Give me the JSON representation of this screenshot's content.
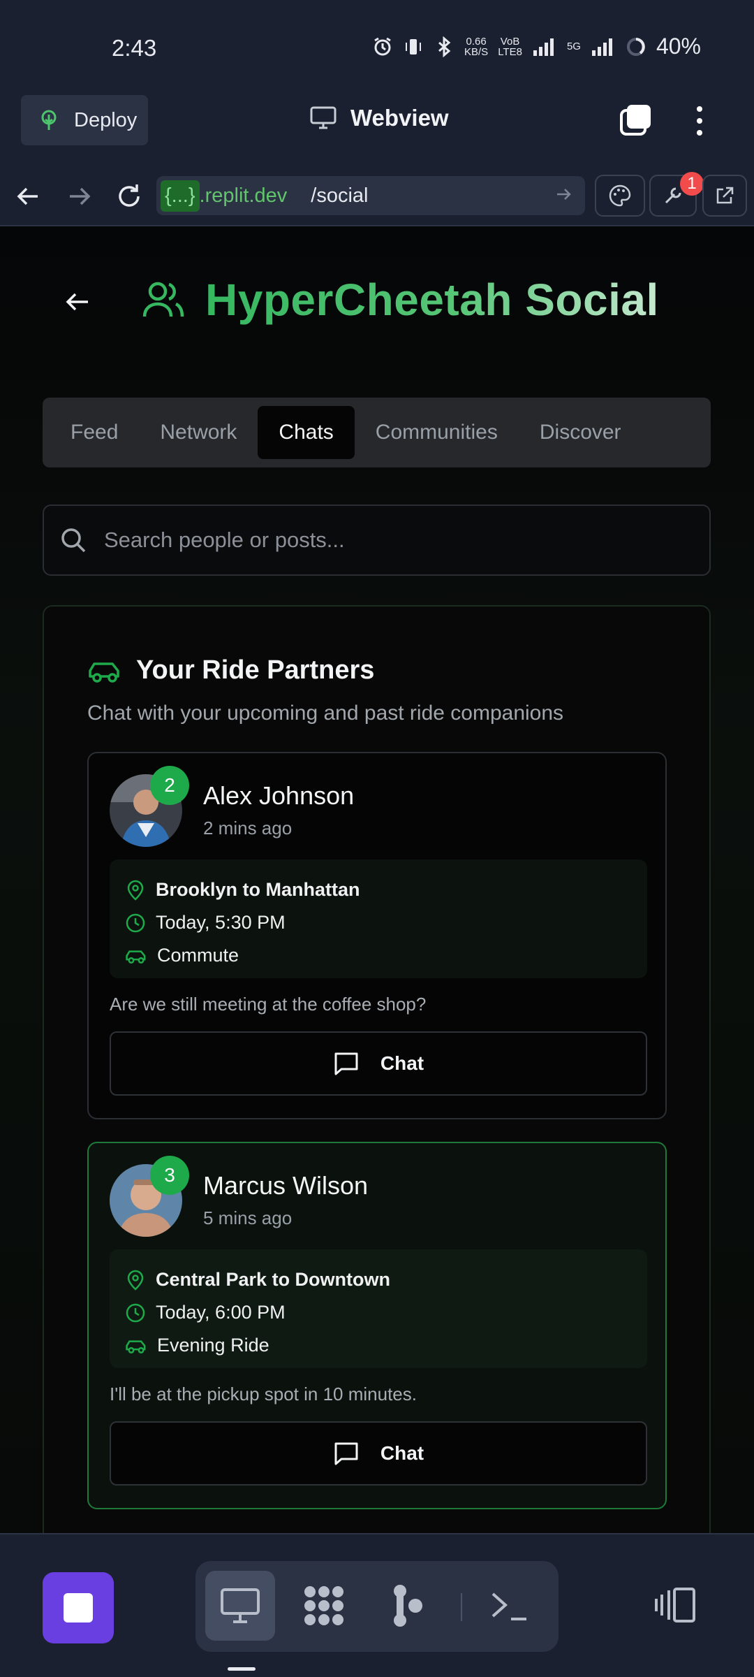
{
  "status_bar": {
    "time": "2:43",
    "net_speed_value": "0.66",
    "net_speed_unit": "KB/S",
    "volte_top": "VoB",
    "volte_bottom": "LTE8",
    "network": "5G",
    "battery": "40%"
  },
  "toolbar": {
    "deploy_label": "Deploy",
    "title": "Webview"
  },
  "address": {
    "badge": "{...}",
    "domain": ".replit.dev",
    "path": "/social",
    "notification_count": "1"
  },
  "page": {
    "title": "HyperCheetah Social",
    "tabs": [
      {
        "label": "Feed",
        "active": false
      },
      {
        "label": "Network",
        "active": false
      },
      {
        "label": "Chats",
        "active": true
      },
      {
        "label": "Communities",
        "active": false
      },
      {
        "label": "Discover",
        "active": false
      }
    ],
    "search_placeholder": "Search people or posts...",
    "section_title": "Your Ride Partners",
    "section_subtitle": "Chat with your upcoming and past ride companions",
    "chats": [
      {
        "name": "Alex Johnson",
        "time": "2 mins ago",
        "badge": "2",
        "route": "Brooklyn to Manhattan",
        "when": "Today, 5:30 PM",
        "type": "Commute",
        "message": "Are we still meeting at the coffee shop?",
        "button": "Chat"
      },
      {
        "name": "Marcus Wilson",
        "time": "5 mins ago",
        "badge": "3",
        "route": "Central Park to Downtown",
        "when": "Today, 6:00 PM",
        "type": "Evening Ride",
        "message": "I'll be at the pickup spot in 10 minutes.",
        "button": "Chat"
      }
    ]
  },
  "colors": {
    "accent_green": "#1eaa4b",
    "brand_purple": "#6a3fe2",
    "notification_red": "#f14b4b"
  }
}
